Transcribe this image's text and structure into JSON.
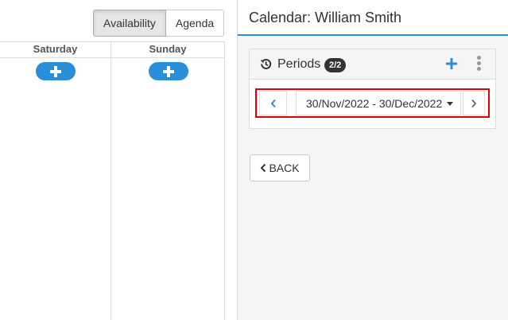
{
  "view_toggle": {
    "availability_label": "Availability",
    "agenda_label": "Agenda"
  },
  "calendar": {
    "days": [
      {
        "label": "Saturday"
      },
      {
        "label": "Sunday"
      }
    ]
  },
  "panel": {
    "title": "Calendar: William Smith",
    "periods": {
      "title": "Periods",
      "badge": "2/2",
      "selected_period": "30/Nov/2022 - 30/Dec/2022"
    },
    "back_label": "BACK"
  },
  "colors": {
    "accent": "#2a8fd8",
    "highlight": "#e00000",
    "badge_bg": "#333333"
  },
  "icons": [
    "history-icon",
    "plus-icon",
    "kebab-menu-icon",
    "chevron-left-icon",
    "chevron-right-icon",
    "caret-down-icon",
    "back-chevron-icon"
  ]
}
